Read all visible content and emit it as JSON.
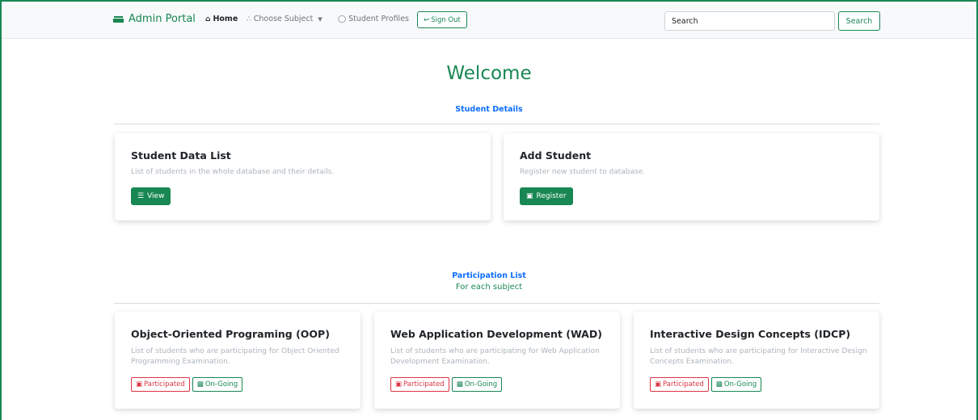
{
  "navbar": {
    "brand": "Admin Portal",
    "home": "Home",
    "choose_subject": "Choose Subject",
    "student_profiles": "Student Profiles",
    "sign_out": "Sign Out",
    "search_placeholder": "Search",
    "search_button": "Search"
  },
  "main": {
    "welcome": "Welcome",
    "student_details_title": "Student Details",
    "participation_title": "Participation List",
    "participation_subtitle": "For each subject"
  },
  "student_cards": [
    {
      "title": "Student Data List",
      "text": "List of students in the whole database and their details.",
      "button": "View"
    },
    {
      "title": "Add Student",
      "text": "Register new student to database.",
      "button": "Register"
    }
  ],
  "subject_cards": [
    {
      "title": "Object-Oriented Programing (OOP)",
      "text": "List of students who are participating for Object Oriented Programming Examination.",
      "participated": "Participated",
      "ongoing": "On-Going"
    },
    {
      "title": "Web Application Development (WAD)",
      "text": "List of students who are participating for Web Application Development Examination.",
      "participated": "Participated",
      "ongoing": "On-Going"
    },
    {
      "title": "Interactive Design Concepts (IDCP)",
      "text": "List of students who are participating for Interactive Design Concepts Examination.",
      "participated": "Participated",
      "ongoing": "On-Going"
    }
  ],
  "colors": {
    "accent": "#198754",
    "link": "#0d6efd",
    "danger": "#dc3545"
  }
}
